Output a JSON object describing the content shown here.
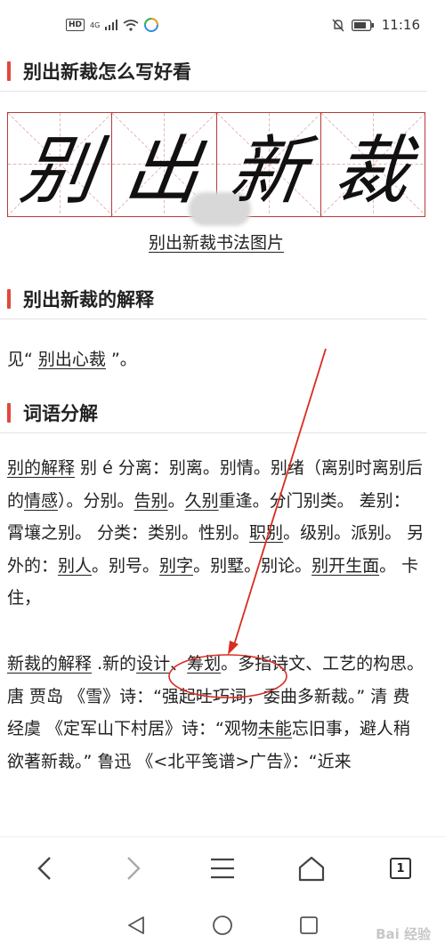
{
  "status": {
    "hd": "HD",
    "network": "4G",
    "time": "11:16"
  },
  "sections": {
    "title1": "别出新裁怎么写好看",
    "calligraphy_chars": [
      "别",
      "出",
      "新",
      "裁"
    ],
    "calligraphy_caption": "别出新裁书法图片",
    "title2": "别出新裁的解释",
    "explain": {
      "prefix": "见“ ",
      "link": "别出心裁",
      "suffix": " ”。"
    },
    "title3": "词语分解"
  },
  "body": {
    "p1": {
      "link1": "别的解释",
      "t1": " 别 é 分离：别离。别情。别绪（离别时离别后的",
      "link2": "情感",
      "t2": "）。分别。",
      "link3": "告别",
      "t3": "。",
      "link4": "久别",
      "t4": "重逢。分门别类。 差别：霄壤之别。 分类：类别。性别。",
      "link5": "职别",
      "t5": "。级别。派别。 另外的：",
      "link6": "别人",
      "t6": "。别号。",
      "link7": "别字",
      "t7": "。别墅。别论。",
      "link8": "别开生面",
      "t8": "。 卡住，"
    },
    "p2": {
      "link1": "新裁的解释",
      "t1": " .新的",
      "link2": "设计",
      "t2": "、",
      "link3": "筹划",
      "t3": "。多指诗文、工艺的构思。 唐 贾岛 《雪》诗：“强起吐巧词，委曲多新裁。” 清 费经虞 《定军山下村居》诗：“观物",
      "link4": "未能",
      "t4": "忘旧事，避人稍欲著新裁。” 鲁迅 《<北平笺谱>广告》：“近来"
    }
  },
  "browser_nav": {
    "back": "back-arrow-icon",
    "forward": "forward-arrow-icon",
    "menu": "menu-icon",
    "home": "home-icon",
    "tabs_count": "1"
  },
  "system_nav": [
    "back-triangle-icon",
    "home-circle-icon",
    "recents-square-icon"
  ],
  "watermark": "Bai 经验",
  "colors": {
    "accent": "#e0483e",
    "annotation": "#d92b20",
    "grid": "#b73a3a"
  }
}
